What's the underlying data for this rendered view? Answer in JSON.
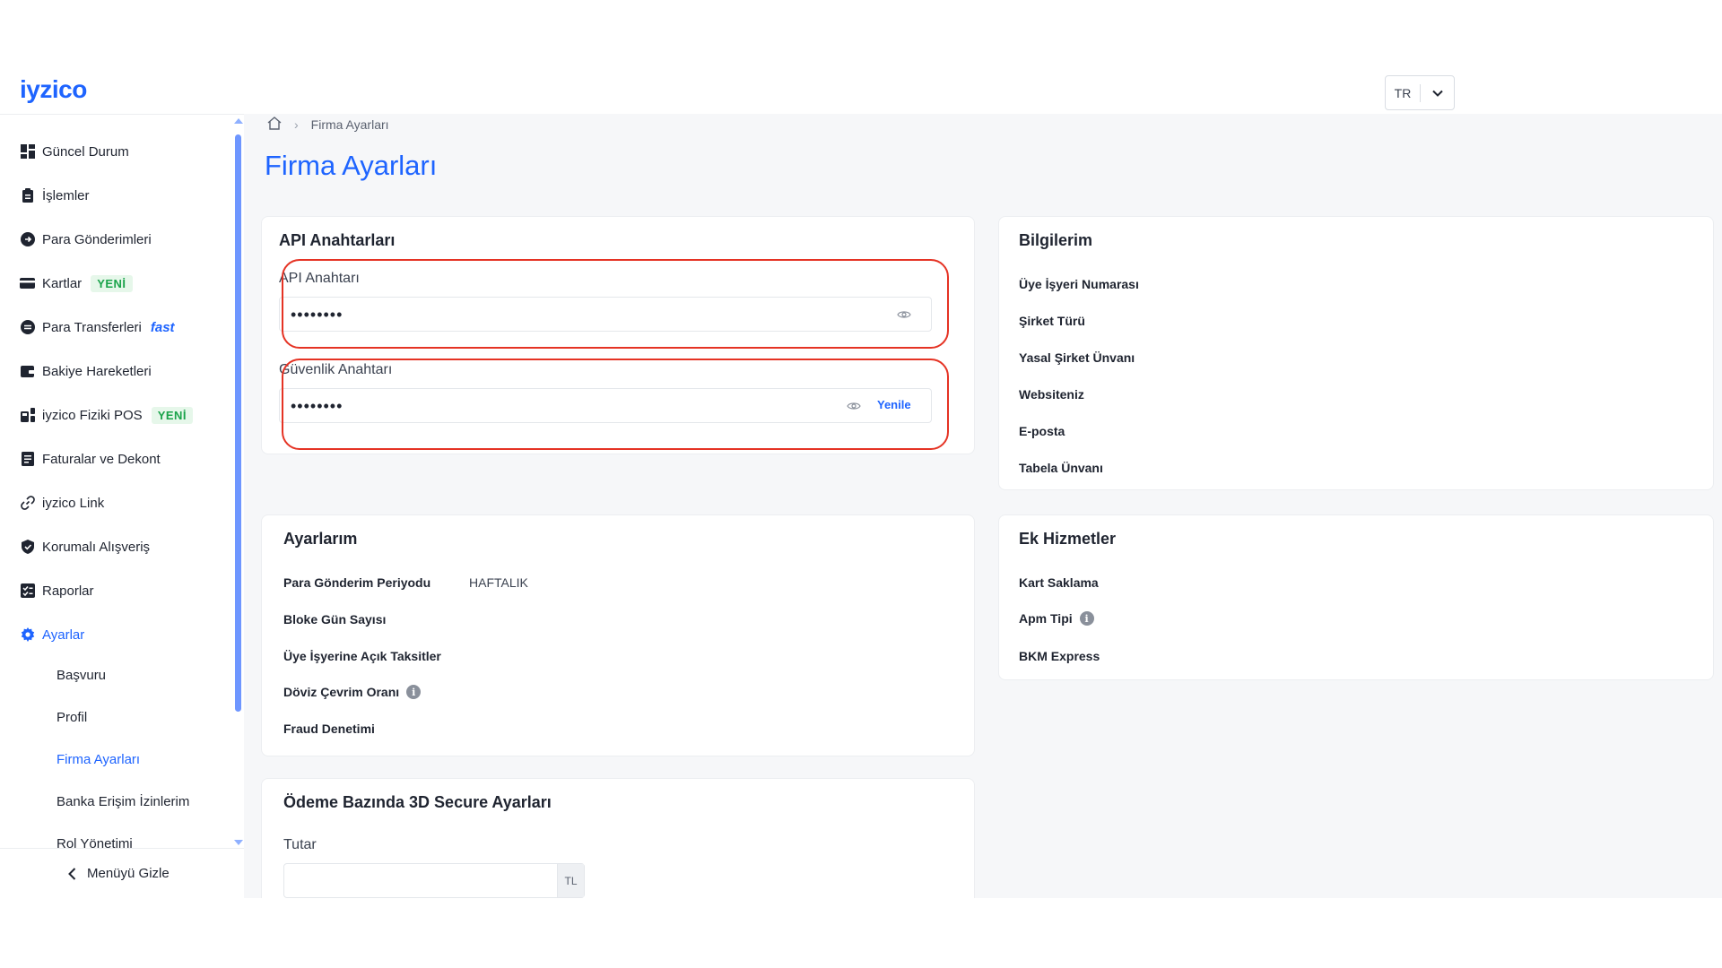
{
  "header": {
    "logo": "iyzico",
    "language": "TR"
  },
  "sidebar": {
    "items": [
      {
        "label": "Güncel Durum",
        "icon": "dashboard-icon"
      },
      {
        "label": "İşlemler",
        "icon": "clipboard-icon"
      },
      {
        "label": "Para Gönderimleri",
        "icon": "money-send-icon"
      },
      {
        "label": "Kartlar",
        "icon": "card-icon",
        "badge": "YENİ"
      },
      {
        "label": "Para Transferleri",
        "icon": "transfer-icon",
        "tag": "fast"
      },
      {
        "label": "Bakiye Hareketleri",
        "icon": "wallet-icon"
      },
      {
        "label": "iyzico Fiziki POS",
        "icon": "pos-icon",
        "badge": "YENİ"
      },
      {
        "label": "Faturalar ve Dekont",
        "icon": "invoice-icon"
      },
      {
        "label": "iyzico Link",
        "icon": "link-icon"
      },
      {
        "label": "Korumalı Alışveriş",
        "icon": "shield-icon"
      },
      {
        "label": "Raporlar",
        "icon": "report-icon"
      },
      {
        "label": "Ayarlar",
        "icon": "gear-icon"
      }
    ],
    "sub_items": [
      {
        "label": "Başvuru"
      },
      {
        "label": "Profil"
      },
      {
        "label": "Firma Ayarları"
      },
      {
        "label": "Banka Erişim İzinlerim"
      },
      {
        "label": "Rol Yönetimi"
      }
    ],
    "hide_menu": "Menüyü Gizle"
  },
  "breadcrumb": {
    "current": "Firma Ayarları"
  },
  "page_title": "Firma Ayarları",
  "api_card": {
    "title": "API Anahtarları",
    "api_key_label": "API Anahtarı",
    "api_key_value": "••••••••",
    "secret_key_label": "Güvenlik Anahtarı",
    "secret_key_value": "••••••••",
    "renew": "Yenile"
  },
  "info_card": {
    "title": "Bilgilerim",
    "rows": [
      "Üye İşyeri Numarası",
      "Şirket Türü",
      "Yasal Şirket Ünvanı",
      "Websiteniz",
      "E-posta",
      "Tabela Ünvanı"
    ]
  },
  "settings_card": {
    "title": "Ayarlarım",
    "rows": [
      {
        "label": "Para Gönderim Periyodu",
        "value": "HAFTALIK"
      },
      {
        "label": "Bloke Gün Sayısı",
        "value": ""
      },
      {
        "label": "Üye İşyerine Açık Taksitler",
        "value": ""
      },
      {
        "label": "Döviz Çevrim Oranı",
        "value": ""
      },
      {
        "label": "Fraud Denetimi",
        "value": ""
      }
    ]
  },
  "extra_card": {
    "title": "Ek Hizmetler",
    "rows": [
      "Kart Saklama",
      "Apm Tipi",
      "BKM Express"
    ]
  },
  "secure_card": {
    "title": "Ödeme Bazında 3D Secure Ayarları",
    "amount_label": "Tutar",
    "amount_value": "",
    "currency": "TL"
  },
  "colors": {
    "accent": "#1e64ff",
    "highlight": "#e53324",
    "badge_green": "#1aa34a"
  }
}
